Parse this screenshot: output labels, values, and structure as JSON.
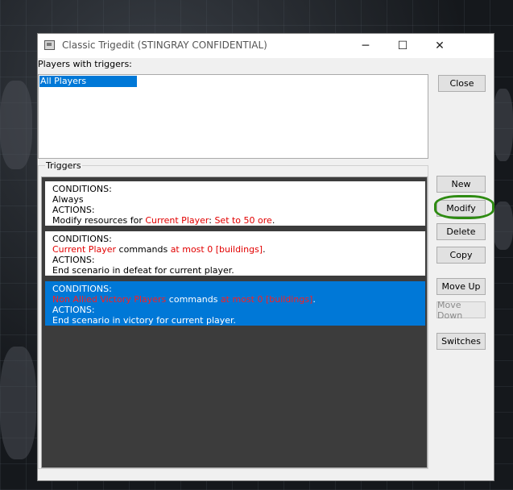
{
  "window": {
    "title": "Classic Trigedit (STINGRAY CONFIDENTIAL)",
    "minimize_glyph": "─",
    "maximize_glyph": "☐",
    "close_glyph": "✕"
  },
  "players": {
    "label": "Players with triggers:",
    "items": [
      "All Players"
    ],
    "selected": "All Players"
  },
  "buttons": {
    "close": "Close",
    "new": "New",
    "modify": "Modify",
    "delete": "Delete",
    "copy": "Copy",
    "move_up": "Move Up",
    "move_down": "Move Down",
    "switches": "Switches"
  },
  "triggers": {
    "label": "Triggers",
    "items": [
      {
        "conditions_label": "CONDITIONS:",
        "condition": {
          "p1": "Always",
          "red1": "",
          "p2": "",
          "red2": "",
          "p3": ""
        },
        "actions_label": "ACTIONS:",
        "action": {
          "p1": "Modify resources for ",
          "red1": "Current Player",
          "p2": ": ",
          "red2": "Set to 50 ore",
          "p3": "."
        }
      },
      {
        "conditions_label": "CONDITIONS:",
        "condition": {
          "p1": "",
          "red1": "Current Player",
          "p2": " commands ",
          "red2": "at most 0 [buildings]",
          "p3": "."
        },
        "actions_label": "ACTIONS:",
        "action": {
          "p1": "End scenario in defeat for current player.",
          "red1": "",
          "p2": "",
          "red2": "",
          "p3": ""
        }
      },
      {
        "conditions_label": "CONDITIONS:",
        "condition": {
          "p1": "",
          "red1": "Non Allied Victory Players",
          "p2": " commands ",
          "red2": "at most 0 [buildings]",
          "p3": "."
        },
        "actions_label": "ACTIONS:",
        "action": {
          "p1": "End scenario in victory for current player.",
          "red1": "",
          "p2": "",
          "red2": "",
          "p3": ""
        }
      }
    ],
    "selected_index": 2
  },
  "colors": {
    "selection": "#0078d7",
    "highlight_text": "#e20000",
    "annotation": "#2e8b12"
  }
}
